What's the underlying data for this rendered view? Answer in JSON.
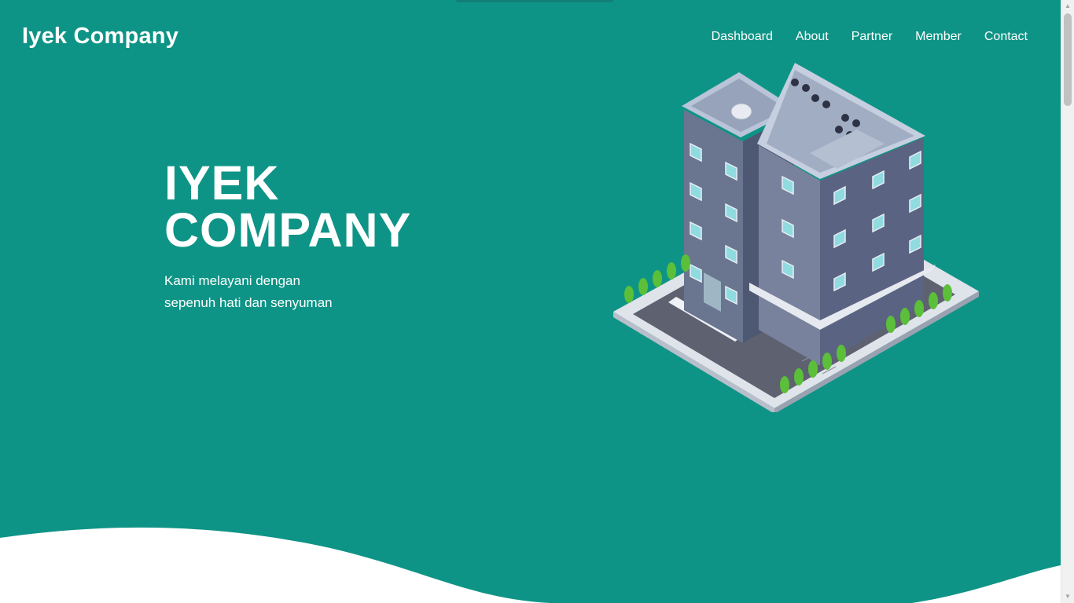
{
  "brand": {
    "name": "Iyek Company"
  },
  "nav": {
    "items": [
      {
        "label": "Dashboard"
      },
      {
        "label": "About"
      },
      {
        "label": "Partner"
      },
      {
        "label": "Member"
      },
      {
        "label": "Contact"
      }
    ]
  },
  "hero": {
    "title_line1": "IYEK",
    "title_line2": "COMPANY",
    "subtitle_line1": "Kami melayani dengan",
    "subtitle_line2": "sepenuh hati dan senyuman"
  },
  "colors": {
    "background": "#0e9486",
    "text": "#ffffff",
    "wave": "#ffffff"
  },
  "icons": {
    "scroll_up": "arrow-up-icon",
    "scroll_down": "arrow-down-icon"
  }
}
